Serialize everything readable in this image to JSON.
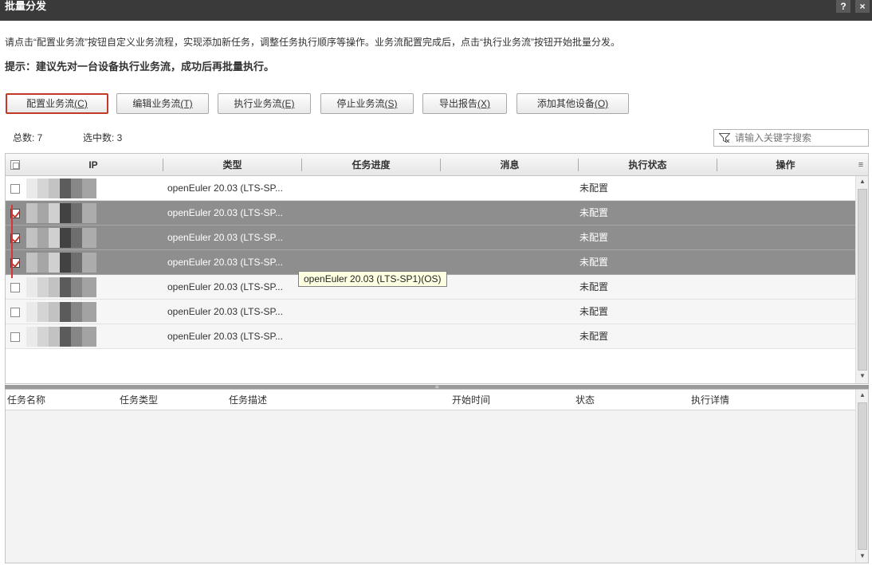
{
  "window": {
    "title": "批量分发",
    "help_label": "?",
    "close_label": "×"
  },
  "intro_text": "请点击“配置业务流”按钮自定义业务流程，实现添加新任务，调整任务执行顺序等操作。业务流配置完成后，点击“执行业务流”按钮开始批量分发。",
  "hint_text": "提示：建议先对一台设备执行业务流，成功后再批量执行。",
  "toolbar": {
    "configure": {
      "label": "配置业务流",
      "key": "(C)"
    },
    "edit": {
      "label": "编辑业务流",
      "key": "(T)"
    },
    "execute": {
      "label": "执行业务流",
      "key": "(E)"
    },
    "stop": {
      "label": "停止业务流",
      "key": "(S)"
    },
    "export": {
      "label": "导出报告",
      "key": "(X)"
    },
    "add_device": {
      "label": "添加其他设备",
      "key": "(O)"
    }
  },
  "counts": {
    "total_label": "总数: 7",
    "selected_label": "选中数: 3"
  },
  "search": {
    "placeholder": "请输入关键字搜索"
  },
  "device_table": {
    "columns": [
      "IP",
      "类型",
      "任务进度",
      "消息",
      "执行状态",
      "操作"
    ],
    "rows": [
      {
        "type": "openEuler 20.03 (LTS-SP...",
        "status": "未配置",
        "checked": false
      },
      {
        "type": "openEuler 20.03 (LTS-SP...",
        "status": "未配置",
        "checked": true
      },
      {
        "type": "openEuler 20.03 (LTS-SP...",
        "status": "未配置",
        "checked": true
      },
      {
        "type": "openEuler 20.03 (LTS-SP...",
        "status": "未配置",
        "checked": true
      },
      {
        "type": "openEuler 20.03 (LTS-SP...",
        "status": "未配置",
        "checked": false
      },
      {
        "type": "openEuler 20.03 (LTS-SP...",
        "status": "未配置",
        "checked": false
      },
      {
        "type": "openEuler 20.03 (LTS-SP...",
        "status": "未配置",
        "checked": false
      }
    ]
  },
  "tooltip": "openEuler 20.03 (LTS-SP1)(OS)",
  "task_table": {
    "columns": [
      "任务名称",
      "任务类型",
      "任务描述",
      "开始时间",
      "状态",
      "执行详情"
    ]
  }
}
